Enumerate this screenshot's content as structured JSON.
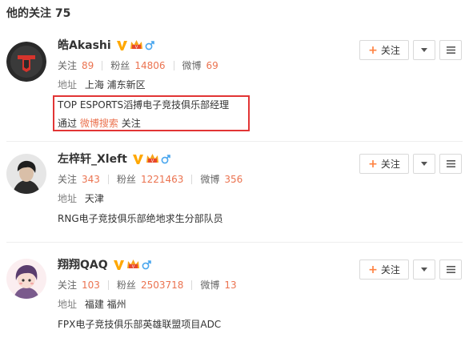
{
  "page": {
    "title": "他的关注 75"
  },
  "colors": {
    "accent": "#eb7350",
    "highlight_border": "#e23535",
    "gender_male": "#49a6ee",
    "v_badge": "#ffa800",
    "follow_plus": "#ff8140"
  },
  "icons": {
    "verified": "v-verified-icon",
    "member": "crown-member-icon",
    "gender": "male-gender-icon",
    "dropdown": "caret-down-icon",
    "more": "hamburger-menu-icon",
    "follow": "plus-icon"
  },
  "users": [
    {
      "name": "皓Akashi",
      "following_label": "关注",
      "following": "89",
      "fans_label": "粉丝",
      "fans": "14806",
      "weibo_label": "微博",
      "weibo": "69",
      "address_label": "地址",
      "address": "上海 浦东新区",
      "intro": "TOP ESPORTS滔搏电子竞技俱乐部经理",
      "source_prefix": "通过",
      "source_link": "微博搜索",
      "source_suffix": "关注",
      "follow_label": "关注"
    },
    {
      "name": "左梓轩_Xleft",
      "following_label": "关注",
      "following": "343",
      "fans_label": "粉丝",
      "fans": "1221463",
      "weibo_label": "微博",
      "weibo": "356",
      "address_label": "地址",
      "address": "天津",
      "intro": "RNG电子竞技俱乐部绝地求生分部队员",
      "follow_label": "关注"
    },
    {
      "name": "翔翔QAQ",
      "following_label": "关注",
      "following": "103",
      "fans_label": "粉丝",
      "fans": "2503718",
      "weibo_label": "微博",
      "weibo": "13",
      "address_label": "地址",
      "address": "福建 福州",
      "intro": "FPX电子竞技俱乐部英雄联盟项目ADC",
      "follow_label": "关注"
    }
  ]
}
